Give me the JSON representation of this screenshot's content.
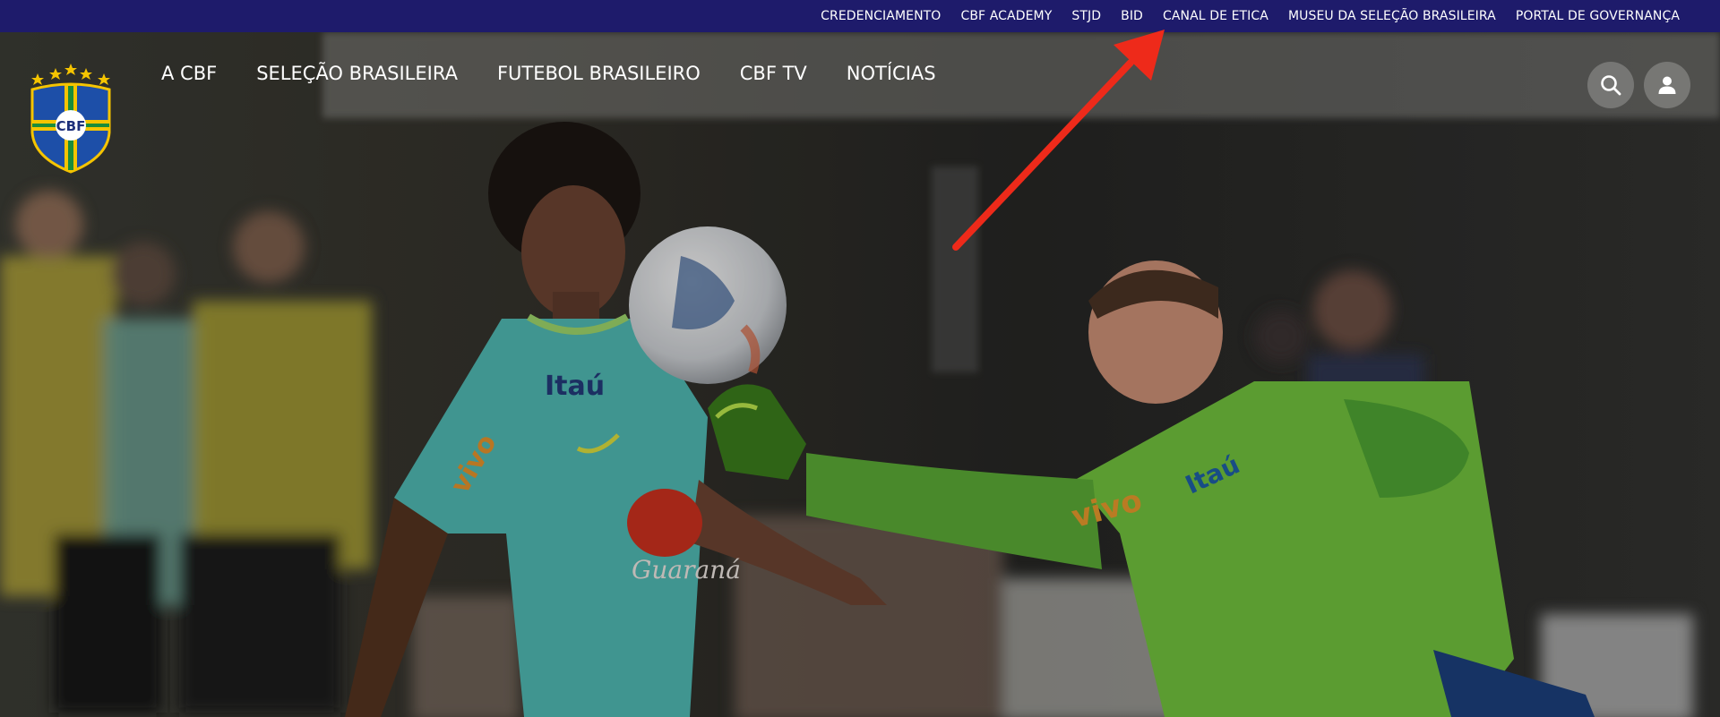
{
  "top_links": [
    "CREDENCIAMENTO",
    "CBF ACADEMY",
    "STJD",
    "BID",
    "CANAL DE ETICA",
    "MUSEU DA SELEÇÃO BRASILEIRA",
    "PORTAL DE GOVERNANÇA"
  ],
  "main_nav": [
    "A CBF",
    "SELEÇÃO BRASILEIRA",
    "FUTEBOL BRASILEIRO",
    "CBF TV",
    "NOTÍCIAS"
  ],
  "logo": {
    "text": "CBF",
    "alt": "CBF crest"
  },
  "hero": {
    "sponsor_left_shirt": "Itaú",
    "sponsor_left_sleeve": "vivo",
    "sponsor_left_chest": "Guaraná",
    "sponsor_right_shirt": "Itaú",
    "sponsor_right_sleeve": "vivo"
  },
  "icons": {
    "search": "search-icon",
    "user": "user-icon",
    "annotation": "red-arrow-annotation"
  },
  "colors": {
    "topbar": "#1e1b6b",
    "arrow": "#ee2a1a",
    "jersey_left": "#4fb6b0",
    "jersey_right": "#6fbf3c"
  }
}
